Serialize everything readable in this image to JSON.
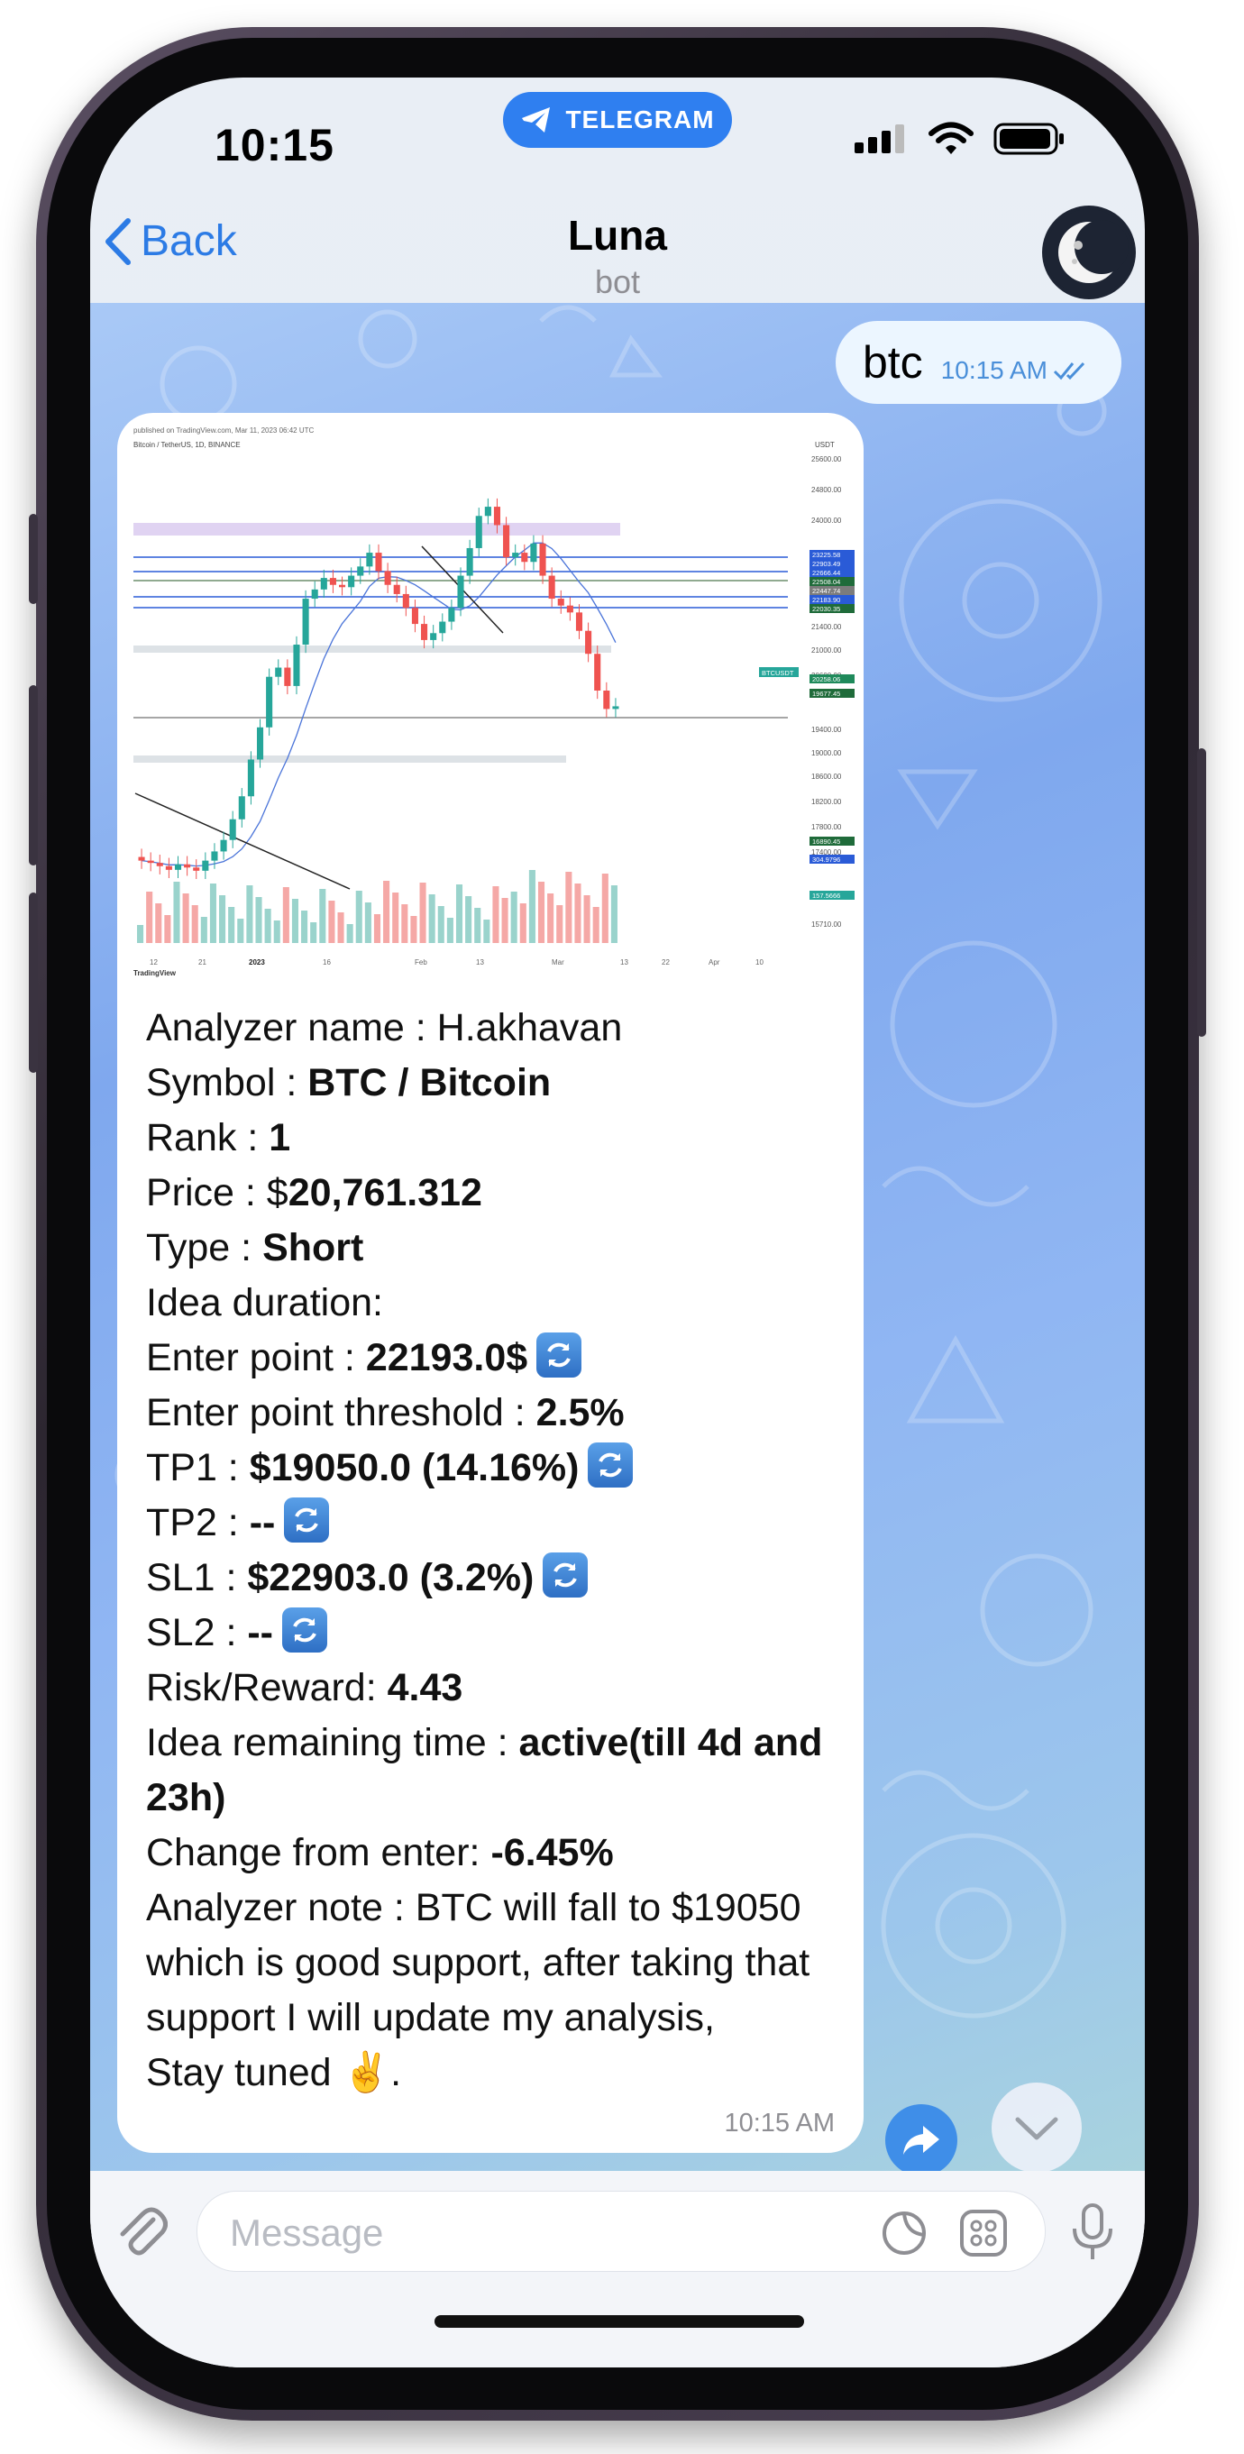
{
  "status_bar": {
    "time": "10:15",
    "app_pill": "TELEGRAM"
  },
  "nav": {
    "back_label": "Back",
    "title": "Luna",
    "subtitle": "bot"
  },
  "outgoing": {
    "text": "btc",
    "time": "10:15 AM"
  },
  "incoming": {
    "image_alt": "TradingView chart: Bitcoin / TetherUS",
    "lines": [
      {
        "parts": [
          {
            "t": "Analyzer name : "
          },
          {
            "t": "H.akhavan"
          }
        ]
      },
      {
        "parts": [
          {
            "t": "Symbol : "
          },
          {
            "t": "BTC / Bitcoin",
            "b": true
          }
        ]
      },
      {
        "parts": [
          {
            "t": "Rank : "
          },
          {
            "t": "1",
            "b": true
          }
        ]
      },
      {
        "parts": [
          {
            "t": "Price : $"
          },
          {
            "t": "20,761.312",
            "b": true
          }
        ]
      },
      {
        "parts": [
          {
            "t": "Type : "
          },
          {
            "t": "Short",
            "b": true
          }
        ]
      },
      {
        "parts": [
          {
            "t": "Idea duration:"
          }
        ]
      },
      {
        "parts": [
          {
            "t": "Enter point : "
          },
          {
            "t": "22193.0$",
            "b": true
          }
        ],
        "refresh": true
      },
      {
        "parts": [
          {
            "t": "Enter point threshold : "
          },
          {
            "t": "2.5%",
            "b": true
          }
        ]
      },
      {
        "parts": [
          {
            "t": "TP1 : "
          },
          {
            "t": "$19050.0 (14.16%)",
            "b": true
          }
        ],
        "refresh": true
      },
      {
        "parts": [
          {
            "t": "TP2 : "
          },
          {
            "t": "--",
            "b": true
          }
        ],
        "refresh": true
      },
      {
        "parts": [
          {
            "t": "SL1 : "
          },
          {
            "t": "$22903.0 (3.2%)",
            "b": true
          }
        ],
        "refresh": true
      },
      {
        "parts": [
          {
            "t": "SL2 : "
          },
          {
            "t": "--",
            "b": true
          }
        ],
        "refresh": true
      },
      {
        "parts": [
          {
            "t": "Risk/Reward: "
          },
          {
            "t": "4.43",
            "b": true
          }
        ]
      },
      {
        "parts": [
          {
            "t": "Idea remaining time : "
          },
          {
            "t": "active(till 4d and 23h)",
            "b": true
          }
        ]
      },
      {
        "parts": [
          {
            "t": "Change from enter: "
          },
          {
            "t": "-6.45%",
            "b": true
          }
        ]
      },
      {
        "parts": [
          {
            "t": "Analyzer note : BTC will fall to $19050 which is good support, after taking that support I will update my analysis,"
          }
        ]
      },
      {
        "parts": [
          {
            "t": "Stay tuned ✌️."
          }
        ]
      }
    ],
    "time": "10:15 AM"
  },
  "chart_data": {
    "type": "candlestick",
    "header": "Bitcoin / TetherUS, 1D, BINANCE",
    "published": "published on TradingView.com, Mar 11, 2023 06:42 UTC",
    "y_ticks": [
      "25600.00",
      "24800.00",
      "24000.00",
      "21400.00",
      "21000.00",
      "20600.00",
      "19400.00",
      "19000.00",
      "18600.00",
      "18200.00",
      "17800.00",
      "17400.00",
      "16330.00",
      "15710.00"
    ],
    "price_labels": [
      "23225.58",
      "22903.49",
      "22666.44",
      "22508.04",
      "22447.74",
      "22183.90",
      "22030.35",
      "20258.06",
      "19677.45",
      "16890.45",
      "304.9796",
      "157.5666"
    ],
    "x_ticks": [
      "12",
      "21",
      "2023",
      "16",
      "Feb",
      "13",
      "Mar",
      "13",
      "22",
      "Apr",
      "10"
    ],
    "y_unit": "USDT",
    "current_price_tag": "BTCUSDT",
    "brand": "TradingView",
    "closes": [
      16900,
      16850,
      16780,
      16700,
      16820,
      16750,
      16680,
      16900,
      17100,
      17350,
      17800,
      18300,
      19100,
      19800,
      20900,
      21100,
      20700,
      21600,
      22600,
      22800,
      23050,
      22900,
      22850,
      23100,
      23300,
      23600,
      23200,
      22900,
      22700,
      22400,
      22050,
      21700,
      21850,
      22100,
      22400,
      23100,
      23700,
      24400,
      24600,
      24200,
      23500,
      23600,
      23400,
      23800,
      23100,
      22600,
      22450,
      22300,
      21900,
      21400,
      20600,
      20200,
      20258
    ]
  },
  "input": {
    "placeholder": "Message"
  },
  "colors": {
    "accent": "#2f7ff0",
    "bubble_out": "#ecf6ff",
    "bubble_in": "#ffffff",
    "up": "#26a69a",
    "down": "#ef5350"
  }
}
